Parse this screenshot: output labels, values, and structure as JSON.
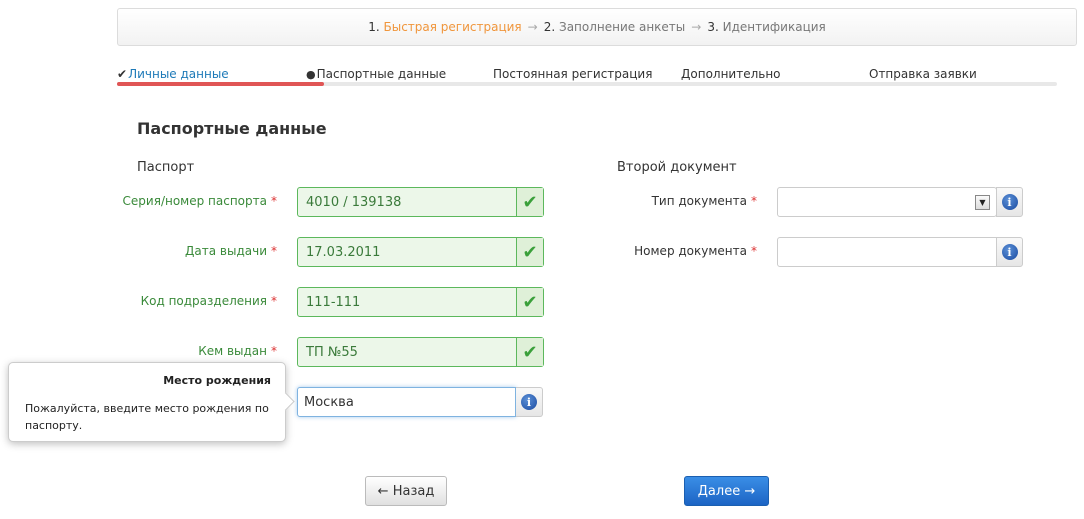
{
  "steps": [
    {
      "num": "1.",
      "label": "Быстрая регистрация",
      "active": true
    },
    {
      "num": "2.",
      "label": "Заполнение анкеты",
      "active": false
    },
    {
      "num": "3.",
      "label": "Идентификация",
      "active": false
    }
  ],
  "step_arrow": "→",
  "tabs": {
    "personal": "Личные данные",
    "passport": "Паспортные данные",
    "registration": "Постоянная регистрация",
    "additional": "Дополнительно",
    "submit": "Отправка заявки",
    "check_icon": "✔",
    "person_icon": "👤",
    "progress_fraction": 0.22
  },
  "form": {
    "title": "Паспортные данные",
    "passport_section": "Паспорт",
    "second_doc_section": "Второй документ",
    "required_mark": "*",
    "series_label": "Серия/номер паспорта",
    "series_value": "4010 / 139138",
    "issue_date_label": "Дата выдачи",
    "issue_date_value": "17.03.2011",
    "dept_code_label": "Код подразделения",
    "dept_code_value": "111-111",
    "issued_by_label": "Кем выдан",
    "issued_by_value": "ТП №55",
    "birthplace_value": "Москва",
    "doc_type_label": "Тип документа",
    "doc_number_label": "Номер документа",
    "ok_icon": "✔",
    "info_icon": "i",
    "dropdown_icon": "▼"
  },
  "popover": {
    "title": "Место рождения",
    "text": "Пожалуйста, введите место рождения по паспорту."
  },
  "buttons": {
    "back": "← Назад",
    "next": "Далее →"
  },
  "colors": {
    "accent_orange": "#f0963c",
    "valid_green": "#5cb85c",
    "primary_blue": "#1c64c4",
    "progress_red": "#e05555"
  }
}
